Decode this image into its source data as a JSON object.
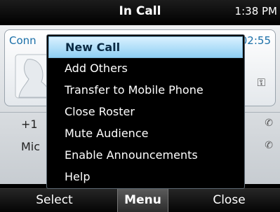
{
  "status_bar": {
    "title": "In Call",
    "time": "1:38 PM"
  },
  "call": {
    "connection_label": "Conn",
    "timer": "02:55",
    "roster": [
      {
        "number": "+1",
        "icon": "phone-icon"
      },
      {
        "number": "Mic",
        "icon": "phone-icon"
      }
    ]
  },
  "menu": {
    "selected_index": 0,
    "items": [
      "New Call",
      "Add Others",
      "Transfer to Mobile Phone",
      "Close Roster",
      "Mute Audience",
      "Enable Announcements",
      "Help"
    ]
  },
  "softkeys": {
    "left": "Select",
    "middle": "Menu",
    "right": "Close"
  },
  "colors": {
    "selected_highlight": "#8fcff3",
    "menu_background": "#000000",
    "accent_text": "#1a6fa8"
  }
}
